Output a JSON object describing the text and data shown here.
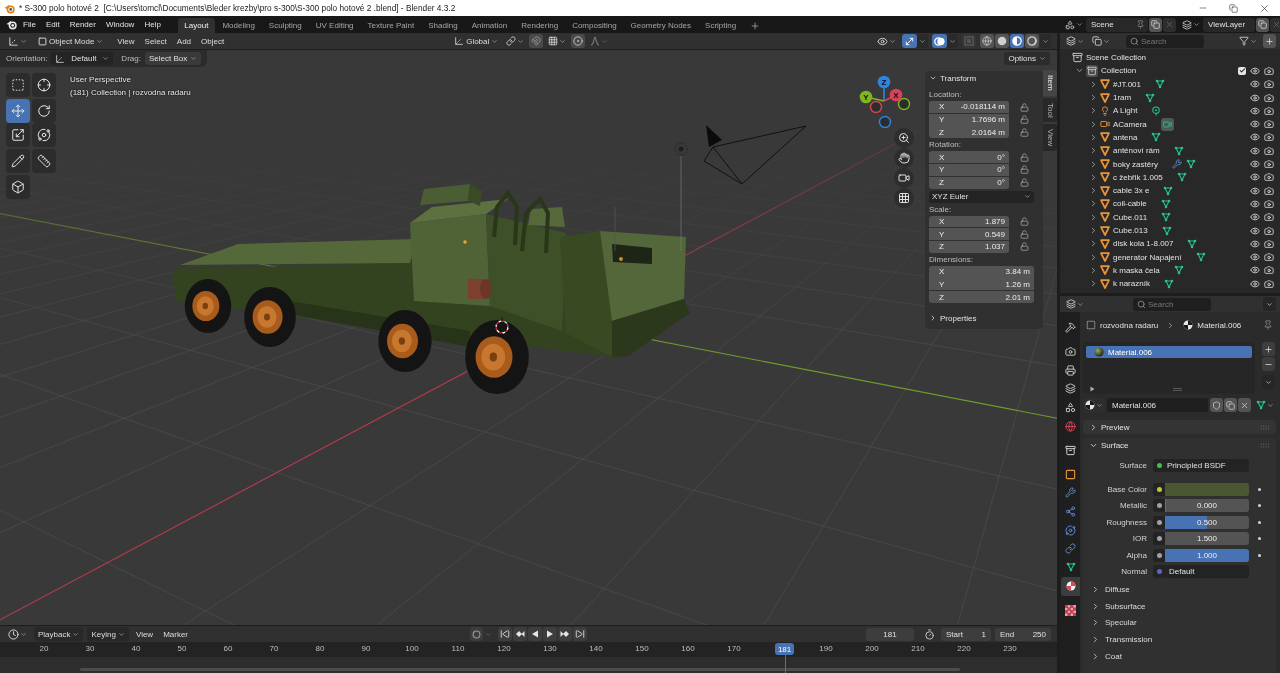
{
  "window": {
    "title": "* S-300 polo hotové 2  [C:\\Users\\tomcl\\Documents\\Bleder krezby\\pro s-300\\S-300 polo hotové 2 .blend] - Blender 4.3.2"
  },
  "menu": [
    "File",
    "Edit",
    "Render",
    "Window",
    "Help"
  ],
  "workspaces": [
    {
      "label": "Layout",
      "selected": true
    },
    {
      "label": "Modeling",
      "selected": false
    },
    {
      "label": "Sculpting",
      "selected": false
    },
    {
      "label": "UV Editing",
      "selected": false
    },
    {
      "label": "Texture Paint",
      "selected": false
    },
    {
      "label": "Shading",
      "selected": false
    },
    {
      "label": "Animation",
      "selected": false
    },
    {
      "label": "Rendering",
      "selected": false
    },
    {
      "label": "Compositing",
      "selected": false
    },
    {
      "label": "Geometry Nodes",
      "selected": false
    },
    {
      "label": "Scripting",
      "selected": false
    }
  ],
  "scene": {
    "name": "Scene",
    "view_layer": "ViewLayer"
  },
  "viewport": {
    "header": {
      "mode": "Object Mode",
      "menus": [
        "View",
        "Select",
        "Add",
        "Object"
      ],
      "orientation": "Global",
      "gizmos": true,
      "overlays": true,
      "xray": false,
      "shading": [
        {
          "kind": "wireframe",
          "selected": false
        },
        {
          "kind": "solid",
          "selected": false
        },
        {
          "kind": "material",
          "selected": true
        },
        {
          "kind": "rendered",
          "selected": false
        }
      ]
    },
    "tool_settings": {
      "orientation_label": "Orientation:",
      "orientation": "Default",
      "drag_label": "Drag:",
      "drag": "Select Box",
      "options": "Options"
    },
    "info": [
      "User Perspective",
      "(181) Collection | rozvodna radaru"
    ],
    "tools": [
      {
        "kind": "select",
        "selected": false
      },
      {
        "kind": "cursor",
        "selected": false
      },
      {
        "kind": "move",
        "selected": true
      },
      {
        "kind": "rotate",
        "selected": false
      },
      {
        "kind": "scale",
        "selected": false
      },
      {
        "kind": "transform",
        "selected": false
      },
      {
        "kind": "annotate",
        "selected": false
      },
      {
        "kind": "measure",
        "selected": false
      },
      {
        "kind": "add-cube",
        "selected": false
      }
    ],
    "gizmo": [
      {
        "label": "Z",
        "color": "#2f84e0"
      },
      {
        "label": "Y",
        "color": "#7fb51f"
      },
      {
        "label": "X",
        "color": "#d8415a"
      }
    ],
    "sidebar": {
      "tabs": [
        {
          "label": "Item",
          "selected": true
        },
        {
          "label": "Tool",
          "selected": false
        },
        {
          "label": "View",
          "selected": false
        }
      ],
      "panels": [
        {
          "label": "Transform",
          "expanded": true,
          "groups": [
            {
              "label": "Location:",
              "kind": "lockable",
              "fields": [
                {
                  "axis": "X",
                  "value": "-0.018114 m"
                },
                {
                  "axis": "Y",
                  "value": "1.7696 m"
                },
                {
                  "axis": "Z",
                  "value": "2.0164 m"
                }
              ]
            },
            {
              "label": "Rotation:",
              "kind": "lockable",
              "fields": [
                {
                  "axis": "X",
                  "value": "0°"
                },
                {
                  "axis": "Y",
                  "value": "0°"
                },
                {
                  "axis": "Z",
                  "value": "0°"
                }
              ],
              "mode": "XYZ Euler"
            },
            {
              "label": "Scale:",
              "kind": "lockable",
              "fields": [
                {
                  "axis": "X",
                  "value": "1.879"
                },
                {
                  "axis": "Y",
                  "value": "0.549"
                },
                {
                  "axis": "Z",
                  "value": "1.037"
                }
              ]
            },
            {
              "label": "Dimensions:",
              "kind": "plain",
              "fields": [
                {
                  "axis": "X",
                  "value": "3.84 m"
                },
                {
                  "axis": "Y",
                  "value": "1.26 m"
                },
                {
                  "axis": "Z",
                  "value": "2.01 m"
                }
              ]
            }
          ]
        },
        {
          "label": "Properties",
          "expanded": false
        }
      ]
    }
  },
  "outliner": {
    "search_placeholder": "Search",
    "tree": [
      {
        "label": "Scene Collection",
        "kind": "scene",
        "children": [
          {
            "label": "Collection",
            "kind": "collection",
            "expanded": true,
            "checked": true,
            "children": [
              {
                "label": "#JT.001",
                "kind": "mesh",
                "expanded": false,
                "modifier": false
              },
              {
                "label": "1ram",
                "kind": "mesh",
                "expanded": false,
                "modifier": false
              },
              {
                "label": "A Light",
                "kind": "light",
                "expanded": false,
                "modifier": false
              },
              {
                "label": "ACamera",
                "kind": "camera",
                "expanded": false,
                "modifier": false
              },
              {
                "label": "antena",
                "kind": "mesh",
                "expanded": false,
                "modifier": false
              },
              {
                "label": "anténoví rám",
                "kind": "mesh",
                "expanded": false,
                "modifier": false
              },
              {
                "label": "boky zastěry",
                "kind": "mesh",
                "expanded": false,
                "modifier": true
              },
              {
                "label": "c žebřik 1.005",
                "kind": "mesh",
                "expanded": false,
                "modifier": false
              },
              {
                "label": "cable 3x e",
                "kind": "mesh",
                "expanded": false,
                "modifier": false
              },
              {
                "label": "coil-cable",
                "kind": "mesh",
                "expanded": false,
                "modifier": false
              },
              {
                "label": "Cube.011",
                "kind": "mesh",
                "expanded": false,
                "modifier": false
              },
              {
                "label": "Cube.013",
                "kind": "mesh",
                "expanded": false,
                "modifier": false
              },
              {
                "label": "disk kola 1-8.007",
                "kind": "mesh",
                "expanded": false,
                "modifier": false
              },
              {
                "label": "generator Napajení",
                "kind": "mesh",
                "expanded": false,
                "modifier": false
              },
              {
                "label": "k maska čela",
                "kind": "mesh",
                "expanded": false,
                "modifier": false
              },
              {
                "label": "k narazník",
                "kind": "mesh",
                "expanded": false,
                "modifier": false
              }
            ]
          }
        ]
      }
    ]
  },
  "properties": {
    "search_placeholder": "Search",
    "tabs": [
      {
        "kind": "tool",
        "selected": false
      },
      {
        "kind": "render",
        "selected": false
      },
      {
        "kind": "output",
        "selected": false
      },
      {
        "kind": "view_layer",
        "selected": false
      },
      {
        "kind": "scene",
        "selected": false
      },
      {
        "kind": "world",
        "selected": false
      },
      {
        "kind": "collection",
        "selected": false
      },
      {
        "kind": "object",
        "selected": false
      },
      {
        "kind": "modifiers",
        "selected": false
      },
      {
        "kind": "particles",
        "selected": false
      },
      {
        "kind": "physics",
        "selected": false
      },
      {
        "kind": "constraints",
        "selected": false
      },
      {
        "kind": "data",
        "selected": false
      },
      {
        "kind": "material",
        "selected": true
      },
      {
        "kind": "texture",
        "selected": false
      }
    ],
    "breadcrumb": {
      "object": "rozvodna radaru",
      "material": "Material.006"
    },
    "slots": [
      {
        "label": "Material.006",
        "selected": true
      }
    ],
    "material": "Material.006",
    "panels": [
      {
        "label": "Preview",
        "expanded": false
      },
      {
        "label": "Surface",
        "expanded": true,
        "surface": {
          "label": "Surface",
          "value": "Principled BSDF",
          "color": "#45c04a"
        },
        "inputs": [
          {
            "label": "Base Color",
            "kind": "color",
            "color": "#c7c729",
            "swatch": {
              "color": "#4b5731"
            }
          },
          {
            "label": "Metallic",
            "kind": "slider",
            "color": "#a1a1a1",
            "value": "0.000",
            "level": 0
          },
          {
            "label": "Roughness",
            "kind": "slider",
            "color": "#a1a1a1",
            "value": "0.500",
            "level": 0.5
          },
          {
            "label": "IOR",
            "kind": "number",
            "color": "#a1a1a1",
            "value": "1.500"
          },
          {
            "label": "Alpha",
            "kind": "slider",
            "color": "#a1a1a1",
            "value": "1.000",
            "level": 1
          },
          {
            "label": "Normal",
            "kind": "link",
            "color": "#6363c7",
            "value": "Default"
          }
        ],
        "subpanels": [
          {
            "label": "Diffuse",
            "expanded": false
          },
          {
            "label": "Subsurface",
            "expanded": false
          },
          {
            "label": "Specular",
            "expanded": false
          },
          {
            "label": "Transmission",
            "expanded": false
          },
          {
            "label": "Coat",
            "expanded": false
          }
        ]
      }
    ]
  },
  "timeline": {
    "menus": [
      "Playback",
      "Keying",
      "View",
      "Marker"
    ],
    "auto_key": false,
    "frame": "181",
    "start_label": "Start",
    "start": "1",
    "end_label": "End",
    "end": "250",
    "ruler": [
      "20",
      "30",
      "40",
      "50",
      "60",
      "70",
      "80",
      "90",
      "100",
      "110",
      "120",
      "130",
      "140",
      "150",
      "160",
      "170",
      "190",
      "200",
      "210",
      "220",
      "230"
    ],
    "playhead": "181"
  }
}
